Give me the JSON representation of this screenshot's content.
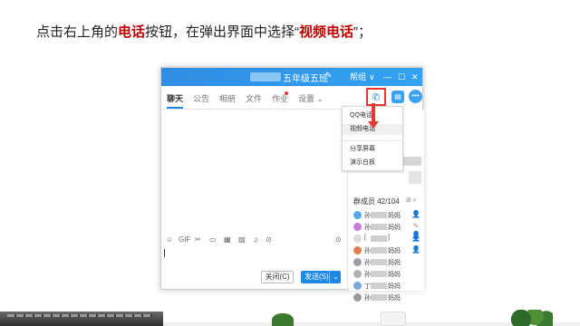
{
  "instruction": {
    "part1": "点击右上角的",
    "highlight1": "电话",
    "part2": "按钮，在弹出界面中选择“",
    "highlight2": "视频电话",
    "part3": "”；"
  },
  "window": {
    "title": "五年级五班",
    "edit_icon": "✎",
    "title_items": [
      "帮组",
      "∨",
      "—",
      "☐",
      "✕"
    ],
    "tabs": [
      "聊天",
      "公告",
      "相册",
      "文件",
      "作业",
      "设置 ⌄"
    ],
    "call_icon": "phone-icon",
    "call_symbol": "✆",
    "chat_symbol": "▤",
    "more_symbol": "•••",
    "dropdown": [
      "QQ电话",
      "视频电话",
      "分享屏幕",
      "演示白板"
    ],
    "toolbar": [
      "☺",
      "GIF",
      "✂",
      "▭",
      "▦",
      "▨",
      "♫",
      "⊙"
    ],
    "toolbar_right": "⊙",
    "close_label": "关闭(C)",
    "send_label": "发送(S)",
    "send_arrow": "⌄",
    "members_title": "群成员 42/104",
    "members_tools": "⊞  ⌕",
    "members": [
      {
        "p1": "孙",
        "p2": "妈妈",
        "color": "#5aa7e8",
        "badge": "👤",
        "badge_color": "#e8a33a"
      },
      {
        "p1": "孙",
        "p2": "妈妈",
        "color": "#c77bd6",
        "badge": "✎ 👤",
        "badge_color": "#999"
      },
      {
        "p1": "[",
        "p2": "]",
        "color": "#dddddd",
        "badge": "👤",
        "badge_color": "#4caf50"
      },
      {
        "p1": "孙",
        "p2": "妈妈",
        "color": "#e08050",
        "badge": "👤",
        "badge_color": "#4caf50"
      },
      {
        "p1": "孙",
        "p2": "妈妈",
        "color": "#9aa0a6",
        "badge": "",
        "badge_color": "#999"
      },
      {
        "p1": "孙",
        "p2": "妈妈",
        "color": "#b0b0b0",
        "badge": "",
        "badge_color": "#999"
      },
      {
        "p1": "丁",
        "p2": "妈妈",
        "color": "#7aa6d8",
        "badge": "",
        "badge_color": "#999"
      },
      {
        "p1": "孙",
        "p2": "妈妈",
        "color": "#999999",
        "badge": "",
        "badge_color": "#999"
      }
    ]
  }
}
